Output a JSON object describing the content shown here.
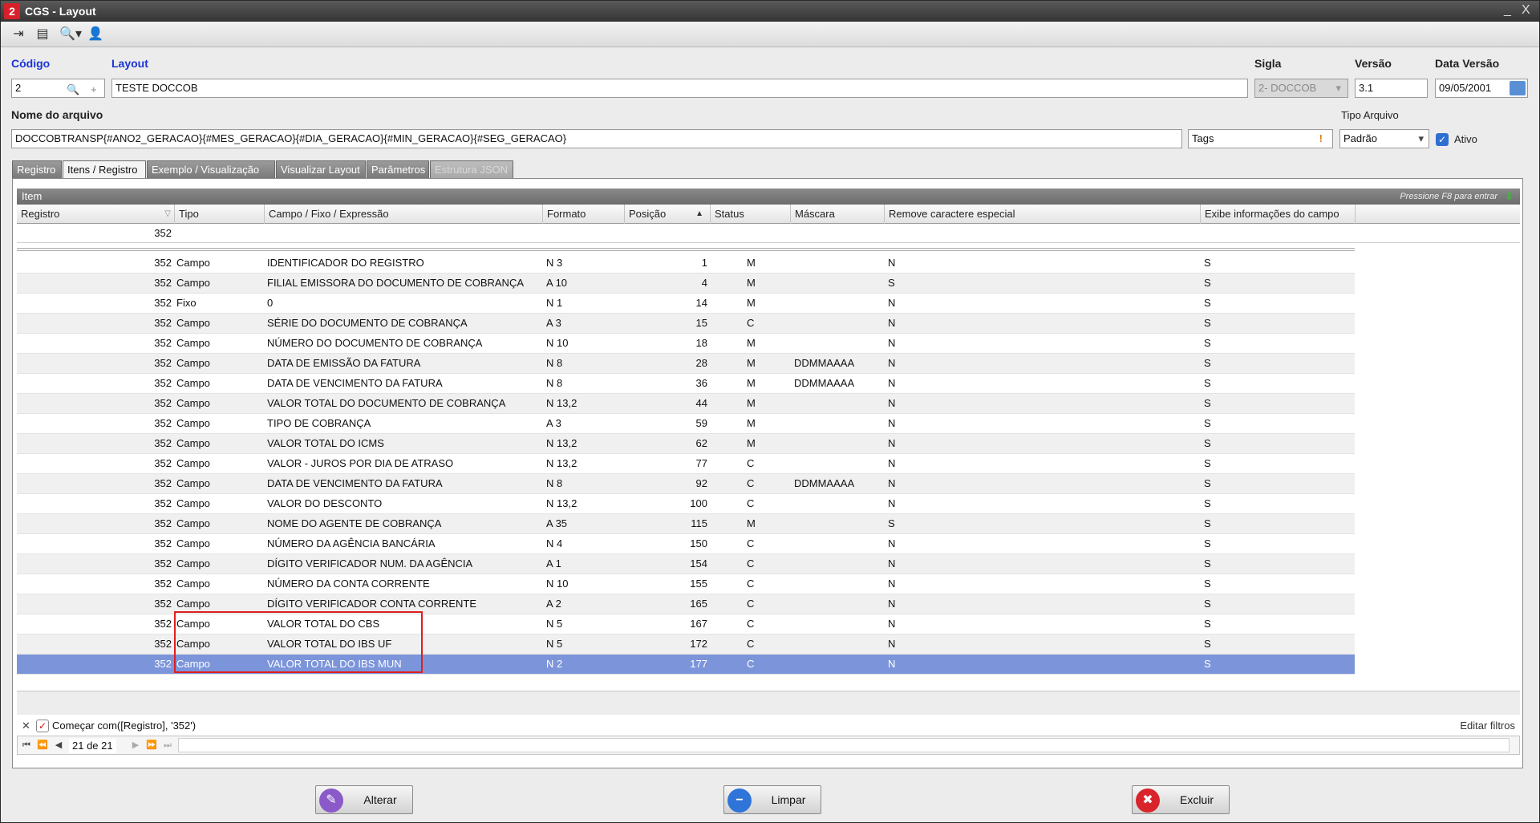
{
  "window": {
    "title": "CGS - Layout",
    "app_icon": "2",
    "minimize": "_",
    "close": "X"
  },
  "form": {
    "codigo_label": "Código",
    "codigo_value": "2",
    "layout_label": "Layout",
    "layout_value": "TESTE DOCCOB",
    "sigla_label": "Sigla",
    "sigla_value": "2- DOCCOB",
    "versao_label": "Versão",
    "versao_value": "3.1",
    "data_versao_label": "Data Versão",
    "data_versao_value": "09/05/2001",
    "nome_arquivo_label": "Nome do arquivo",
    "nome_arquivo_value": "DOCCOBTRANSP{#ANO2_GERACAO}{#MES_GERACAO}{#DIA_GERACAO}{#MIN_GERACAO}{#SEG_GERACAO}",
    "tags_value": "Tags",
    "tipo_arquivo_label": "Tipo Arquivo",
    "tipo_arquivo_value": "Padrão",
    "ativo_label": "Ativo"
  },
  "tabs": [
    "Registro",
    "Itens / Registro",
    "Exemplo / Visualização",
    "Visualizar Layout",
    "Parâmetros",
    "Estrutura JSON"
  ],
  "grid": {
    "group_title": "Item",
    "hint": "Pressione F8 para entrar",
    "columns": [
      "Registro",
      "Tipo",
      "Campo / Fixo / Expressão",
      "Formato",
      "Posição",
      "Status",
      "Máscara",
      "Remove caractere especial",
      "Exibe informações do campo"
    ],
    "filter_value": "352",
    "rows": [
      [
        "352",
        "Campo",
        "IDENTIFICADOR DO REGISTRO",
        "N 3",
        "1",
        "M",
        "",
        "N",
        "S"
      ],
      [
        "352",
        "Campo",
        "FILIAL EMISSORA DO DOCUMENTO DE COBRANÇA",
        "A 10",
        "4",
        "M",
        "",
        "S",
        "S"
      ],
      [
        "352",
        "Fixo",
        "0",
        "N 1",
        "14",
        "M",
        "",
        "N",
        "S"
      ],
      [
        "352",
        "Campo",
        "SÉRIE DO DOCUMENTO DE COBRANÇA",
        "A 3",
        "15",
        "C",
        "",
        "N",
        "S"
      ],
      [
        "352",
        "Campo",
        "NÚMERO DO DOCUMENTO DE COBRANÇA",
        "N 10",
        "18",
        "M",
        "",
        "N",
        "S"
      ],
      [
        "352",
        "Campo",
        "DATA DE EMISSÃO DA FATURA",
        "N 8",
        "28",
        "M",
        "DDMMAAAA",
        "N",
        "S"
      ],
      [
        "352",
        "Campo",
        "DATA DE VENCIMENTO DA FATURA",
        "N 8",
        "36",
        "M",
        "DDMMAAAA",
        "N",
        "S"
      ],
      [
        "352",
        "Campo",
        "VALOR TOTAL DO DOCUMENTO DE COBRANÇA",
        "N 13,2",
        "44",
        "M",
        "",
        "N",
        "S"
      ],
      [
        "352",
        "Campo",
        "TIPO DE COBRANÇA",
        "A 3",
        "59",
        "M",
        "",
        "N",
        "S"
      ],
      [
        "352",
        "Campo",
        "VALOR TOTAL DO ICMS",
        "N 13,2",
        "62",
        "M",
        "",
        "N",
        "S"
      ],
      [
        "352",
        "Campo",
        "VALOR - JUROS POR DIA DE ATRASO",
        "N 13,2",
        "77",
        "C",
        "",
        "N",
        "S"
      ],
      [
        "352",
        "Campo",
        "DATA DE VENCIMENTO DA FATURA",
        "N 8",
        "92",
        "C",
        "DDMMAAAA",
        "N",
        "S"
      ],
      [
        "352",
        "Campo",
        "VALOR DO DESCONTO",
        "N 13,2",
        "100",
        "C",
        "",
        "N",
        "S"
      ],
      [
        "352",
        "Campo",
        "NOME DO AGENTE DE COBRANÇA",
        "A 35",
        "115",
        "M",
        "",
        "S",
        "S"
      ],
      [
        "352",
        "Campo",
        "NÚMERO DA AGÊNCIA BANCÁRIA",
        "N 4",
        "150",
        "C",
        "",
        "N",
        "S"
      ],
      [
        "352",
        "Campo",
        "DÍGITO VERIFICADOR NUM. DA AGÊNCIA",
        "A 1",
        "154",
        "C",
        "",
        "N",
        "S"
      ],
      [
        "352",
        "Campo",
        "NÚMERO DA CONTA CORRENTE",
        "N 10",
        "155",
        "C",
        "",
        "N",
        "S"
      ],
      [
        "352",
        "Campo",
        "DÍGITO VERIFICADOR CONTA CORRENTE",
        "A 2",
        "165",
        "C",
        "",
        "N",
        "S"
      ],
      [
        "352",
        "Campo",
        "VALOR TOTAL DO CBS",
        "N 5",
        "167",
        "C",
        "",
        "N",
        "S"
      ],
      [
        "352",
        "Campo",
        "VALOR TOTAL DO IBS UF",
        "N 5",
        "172",
        "C",
        "",
        "N",
        "S"
      ],
      [
        "352",
        "Campo",
        "VALOR TOTAL DO IBS MUN",
        "N 2",
        "177",
        "C",
        "",
        "N",
        "S"
      ]
    ],
    "selected_row": 20,
    "filter_text": "Começar com([Registro], '352')",
    "edit_filters": "Editar filtros",
    "nav_text": "21 de 21"
  },
  "buttons": {
    "alterar": "Alterar",
    "limpar": "Limpar",
    "excluir": "Excluir"
  },
  "colors": {
    "accent_blue": "#1a34d6",
    "selection": "#7c95da",
    "highlight_box": "#e01e1e"
  }
}
